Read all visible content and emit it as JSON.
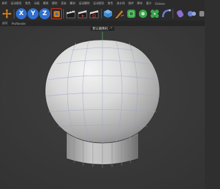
{
  "menu": {
    "items": [
      "体积",
      "运动图形",
      "角色",
      "动画",
      "模拟",
      "跟踪",
      "渲染",
      "雕刻",
      "运动跟踪",
      "运动图形",
      "角色",
      "流水线",
      "插件",
      "脚本",
      "窗口",
      "帮助"
    ],
    "octane": "Octane"
  },
  "toolbar": {
    "axis_x": "X",
    "axis_y": "Y",
    "axis_z": "Z",
    "colors": {
      "move": "#d07a16",
      "axis": "#2f6fcf",
      "highlight": "#d0352b",
      "clapper": "#2a2a2a",
      "cube": "#3d8ed8",
      "green": "#3aa64a",
      "spline": "#6a7fd0"
    },
    "icons": [
      "move-icon",
      "x-axis-icon",
      "y-axis-icon",
      "z-axis-icon",
      "coordinate-system-icon",
      "clapper-icon",
      "render-picture-viewer-icon",
      "render-settings-icon",
      "cube-icon",
      "pen-icon",
      "subdivision-icon",
      "generator-icon",
      "mograph-icon",
      "deformer-icon",
      "scene-icon",
      "camera-icon",
      "light-icon"
    ]
  },
  "subbar": {
    "items": [
      "选项",
      "ProRender"
    ]
  },
  "viewport": {
    "camera_label": "默认摄像机 ◦°"
  }
}
